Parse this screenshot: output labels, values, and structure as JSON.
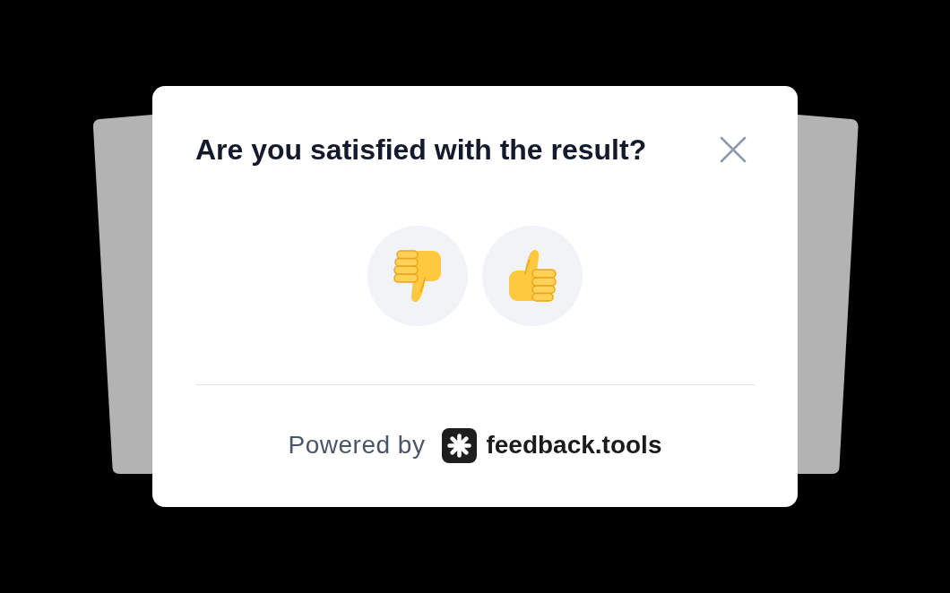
{
  "dialog": {
    "title": "Are you satisfied with the result?",
    "ratings": [
      {
        "kind": "thumbs_down"
      },
      {
        "kind": "thumbs_up"
      }
    ],
    "footer": {
      "powered_by": "Powered by",
      "brand": "feedback.tools"
    }
  }
}
